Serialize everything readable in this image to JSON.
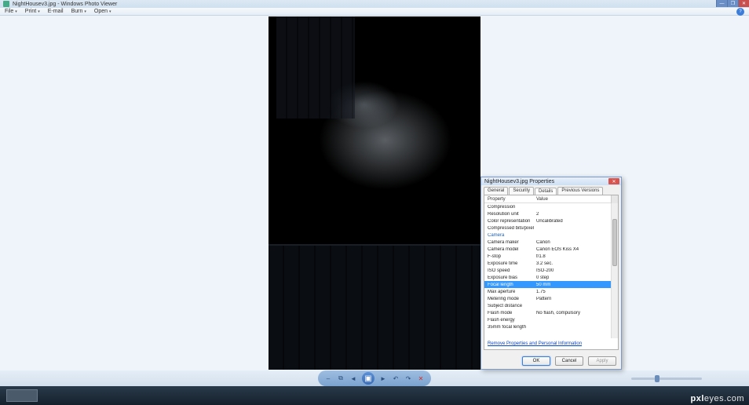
{
  "window": {
    "title": "NightHousev3.jpg - Windows Photo Viewer",
    "win_min": "—",
    "win_max": "❐",
    "win_close": "✕"
  },
  "menu": {
    "file": "File",
    "print": "Print",
    "email": "E-mail",
    "burn": "Burn",
    "open": "Open",
    "help": "?"
  },
  "nav": {
    "prev": "◄",
    "next": "►",
    "play": "▣",
    "rot_l": "↶",
    "rot_r": "↷",
    "del": "✕",
    "zoom_out": "–",
    "zoom_fit": "⧉"
  },
  "dialog": {
    "title": "NightHousev3.jpg Properties",
    "close": "✕",
    "tabs": {
      "general": "General",
      "security": "Security",
      "details": "Details",
      "previous": "Previous Versions"
    },
    "header": {
      "property": "Property",
      "value": "Value"
    },
    "rows": [
      {
        "k": "Compression",
        "v": ""
      },
      {
        "k": "Resolution unit",
        "v": "2"
      },
      {
        "k": "Color representation",
        "v": "Uncalibrated"
      },
      {
        "k": "Compressed bits/pixel",
        "v": ""
      },
      {
        "section": "Camera"
      },
      {
        "k": "Camera maker",
        "v": "Canon"
      },
      {
        "k": "Camera model",
        "v": "Canon EOS Kiss X4"
      },
      {
        "k": "F-stop",
        "v": "f/1.8"
      },
      {
        "k": "Exposure time",
        "v": "3.2 sec."
      },
      {
        "k": "ISO speed",
        "v": "ISO-200"
      },
      {
        "k": "Exposure bias",
        "v": "0 step"
      },
      {
        "k": "Focal length",
        "v": "50 mm",
        "sel": true
      },
      {
        "k": "Max aperture",
        "v": "1.75"
      },
      {
        "k": "Metering mode",
        "v": "Pattern"
      },
      {
        "k": "Subject distance",
        "v": ""
      },
      {
        "k": "Flash mode",
        "v": "No flash, compulsory"
      },
      {
        "k": "Flash energy",
        "v": ""
      },
      {
        "k": "35mm focal length",
        "v": ""
      }
    ],
    "link": "Remove Properties and Personal Information",
    "buttons": {
      "ok": "OK",
      "cancel": "Cancel",
      "apply": "Apply"
    }
  },
  "watermark": {
    "brand": "pxl",
    "rest": "eyes.com"
  }
}
